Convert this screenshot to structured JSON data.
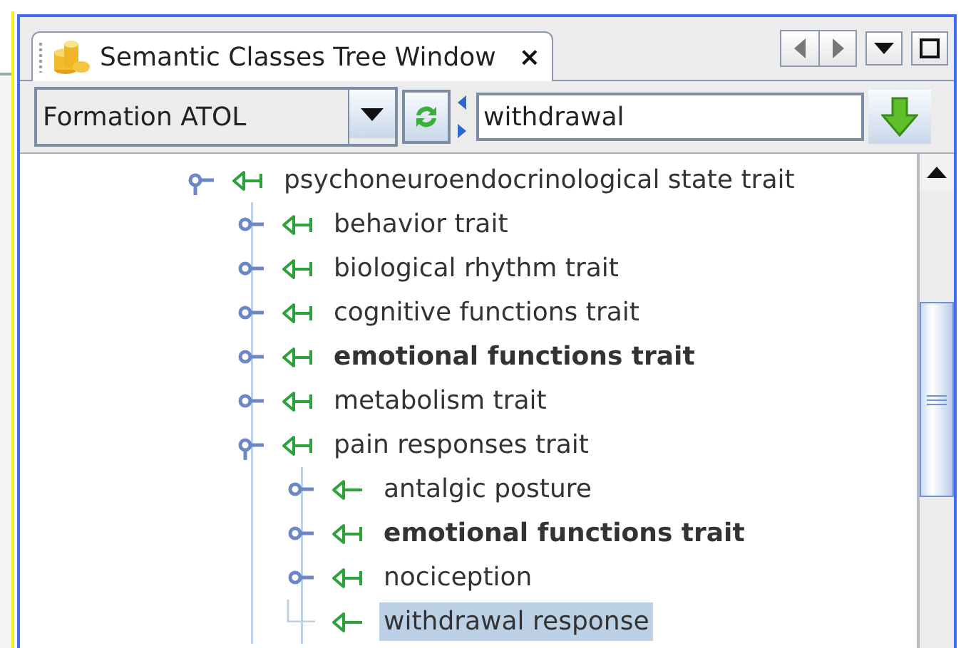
{
  "tab": {
    "title": "Semantic Classes Tree Window",
    "close": "×",
    "selected": true
  },
  "toolbar": {
    "ontology_select": {
      "value": "Formation ATOL"
    },
    "search": {
      "value": "withdrawal"
    }
  },
  "tree": [
    {
      "label": "psychoneuroendocrinological state trait",
      "kind": "branch",
      "expanded": true,
      "bold": false,
      "selected": false,
      "children": [
        {
          "label": "behavior trait",
          "kind": "branch",
          "expanded": false,
          "bold": false,
          "selected": false
        },
        {
          "label": "biological rhythm trait",
          "kind": "branch",
          "expanded": false,
          "bold": false,
          "selected": false
        },
        {
          "label": "cognitive functions trait",
          "kind": "branch",
          "expanded": false,
          "bold": false,
          "selected": false
        },
        {
          "label": "emotional functions trait",
          "kind": "branch",
          "expanded": false,
          "bold": true,
          "selected": false
        },
        {
          "label": "metabolism trait",
          "kind": "branch",
          "expanded": false,
          "bold": false,
          "selected": false
        },
        {
          "label": "pain responses trait",
          "kind": "branch",
          "expanded": true,
          "bold": false,
          "selected": false,
          "children": [
            {
              "label": "antalgic posture",
              "kind": "stub",
              "expanded": false,
              "bold": false,
              "selected": false
            },
            {
              "label": "emotional functions trait",
              "kind": "branch",
              "expanded": false,
              "bold": true,
              "selected": false
            },
            {
              "label": "nociception",
              "kind": "branch",
              "expanded": false,
              "bold": false,
              "selected": false
            },
            {
              "label": "withdrawal response",
              "kind": "leaf",
              "expanded": false,
              "bold": false,
              "selected": true
            }
          ]
        }
      ]
    }
  ]
}
